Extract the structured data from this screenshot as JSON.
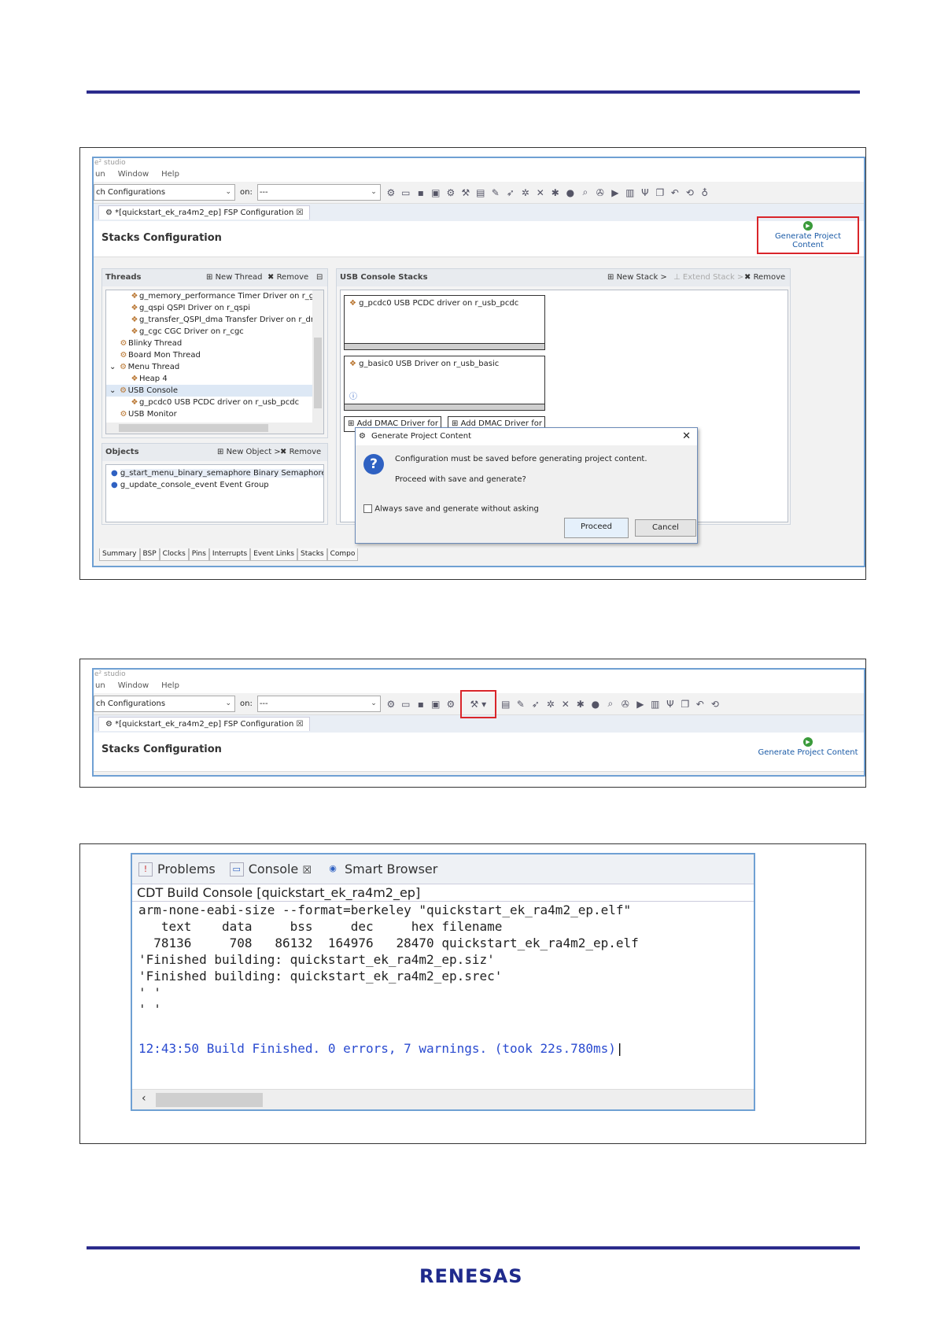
{
  "figure1": {
    "window_title": "e² studio",
    "menu": [
      "un",
      "Window",
      "Help"
    ],
    "config_combo": "ch Configurations",
    "on_label": "on:",
    "on_combo": "---",
    "editor_tab": "*[quickstart_ek_ra4m2_ep] FSP Configuration",
    "editor_tab_close": "☒",
    "pane_title": "Stacks Configuration",
    "generate_label": "Generate Project Content",
    "threads": {
      "header": "Threads",
      "new_thread": "New Thread",
      "remove": "Remove",
      "items": [
        "g_memory_performance Timer Driver on r_gpt",
        "g_qspi QSPI Driver on r_qspi",
        "g_transfer_QSPI_dma Transfer Driver on r_dmac I",
        "g_cgc CGC Driver on r_cgc",
        "Blinky Thread",
        "Board Mon Thread",
        "Menu Thread",
        "Heap 4",
        "USB Console",
        "g_pcdc0 USB PCDC driver on r_usb_pcdc",
        "USB Monitor"
      ]
    },
    "objects": {
      "header": "Objects",
      "new_object": "New Object >",
      "remove": "Remove",
      "items": [
        "g_start_menu_binary_semaphore Binary Semaphore",
        "g_update_console_event Event Group"
      ]
    },
    "stacks": {
      "header": "USB Console Stacks",
      "new_stack": "New Stack >",
      "extend_stack": "Extend Stack >",
      "remove": "Remove",
      "box1": "g_pcdc0 USB PCDC driver on r_usb_pcdc",
      "box2": "g_basic0 USB Driver on r_usb_basic",
      "add1": "Add DMAC Driver for",
      "add2": "Add DMAC Driver for"
    },
    "bottom_tabs": [
      "Summary",
      "BSP",
      "Clocks",
      "Pins",
      "Interrupts",
      "Event Links",
      "Stacks",
      "Compo"
    ],
    "dialog": {
      "title": "Generate Project Content",
      "close": "✕",
      "message1": "Configuration must be saved before generating project content.",
      "message2": "Proceed with save and generate?",
      "checkbox": "Always save and generate without asking",
      "proceed": "Proceed",
      "cancel": "Cancel"
    }
  },
  "figure2": {
    "window_title": "e² studio",
    "menu": [
      "un",
      "Window",
      "Help"
    ],
    "config_combo": "ch Configurations",
    "on_label": "on:",
    "on_combo": "---",
    "editor_tab": "*[quickstart_ek_ra4m2_ep] FSP Configuration",
    "editor_tab_close": "☒",
    "pane_title": "Stacks Configuration",
    "generate_label": "Generate Project Content"
  },
  "figure3": {
    "tabs": [
      "Problems",
      "Console",
      "Smart Browser"
    ],
    "console_title": "CDT Build Console [quickstart_ek_ra4m2_ep]",
    "lines": [
      "arm-none-eabi-size --format=berkeley \"quickstart_ek_ra4m2_ep.elf\"",
      "   text    data     bss     dec     hex filename",
      "  78136     708   86132  164976   28470 quickstart_ek_ra4m2_ep.elf",
      "'Finished building: quickstart_ek_ra4m2_ep.siz'",
      "'Finished building: quickstart_ek_ra4m2_ep.srec'",
      "' '",
      "' '",
      ""
    ],
    "finish_line": "12:43:50 Build Finished. 0 errors, 7 warnings. (took 22s.780ms)"
  },
  "footer": {
    "logo": "RENESAS"
  },
  "colors": {
    "rule": "#2b2b8c",
    "highlight": "#d9252a",
    "window_border": "#6fa0d3",
    "finish_text": "#2a4bd0"
  }
}
